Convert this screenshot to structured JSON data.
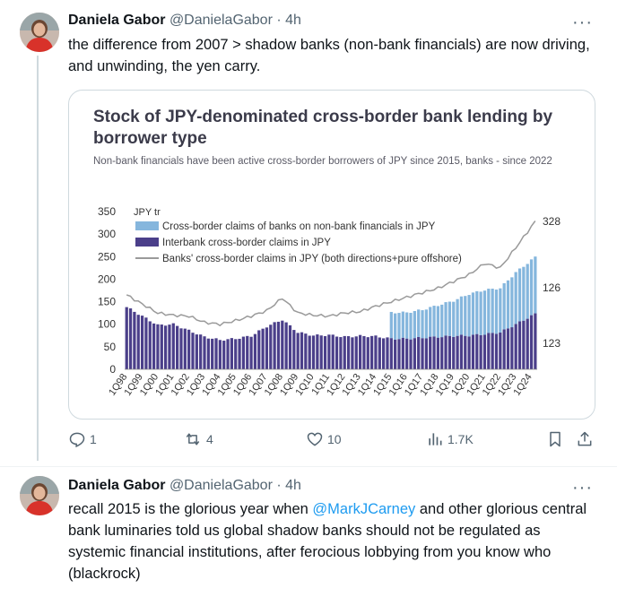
{
  "tweets": [
    {
      "name": "Daniela Gabor",
      "handle": "@DanielaGabor",
      "dot": "·",
      "time": "4h",
      "text": "the difference from 2007 > shadow banks  (non-bank financials) are now driving, and unwinding, the yen carry.",
      "replies": "1",
      "retweets": "4",
      "likes": "10",
      "views": "1.7K"
    },
    {
      "name": "Daniela Gabor",
      "handle": "@DanielaGabor",
      "dot": "·",
      "time": "4h",
      "text_before": "recall 2015 is the glorious year when ",
      "mention": "@MarkJCarney",
      "text_after": " and other glorious central bank luminaries told us global shadow banks should not be regulated as systemic financial institutions, after ferocious lobbying from you know who (blackrock)"
    }
  ],
  "more_glyph": "···",
  "colors": {
    "accent": "#1d9bf0",
    "text": "#0f1419",
    "muted": "#536471",
    "nonbank": "#85b6dd",
    "interbank": "#4b3f8a",
    "line": "#9a9a9a"
  },
  "chart_data": {
    "type": "bar",
    "title": "Stock of JPY-denominated cross-border bank lending by borrower type",
    "subtitle": "Non-bank financials have been active cross-border borrowers of JPY since 2015, banks - since 2022",
    "ylabel": "JPY tr",
    "ylim": [
      0,
      350
    ],
    "yticks": [
      0,
      50,
      100,
      150,
      200,
      250,
      300,
      350
    ],
    "xtick_labels": [
      "1Q98",
      "1Q99",
      "1Q00",
      "1Q01",
      "1Q02",
      "1Q03",
      "1Q04",
      "1Q05",
      "1Q06",
      "1Q07",
      "1Q08",
      "1Q09",
      "1Q10",
      "1Q11",
      "1Q12",
      "1Q13",
      "1Q14",
      "1Q15",
      "1Q16",
      "1Q17",
      "1Q18",
      "1Q19",
      "1Q20",
      "1Q21",
      "1Q22",
      "1Q23",
      "1Q24"
    ],
    "legend": [
      "Cross-border claims of banks on non-bank financials in JPY",
      "Interbank cross-border claims in JPY",
      "Banks' cross-border claims in JPY (both directions+pure offshore)"
    ],
    "end_labels": [
      "328",
      "126",
      "123"
    ],
    "series": [
      {
        "name": "Interbank cross-border claims in JPY",
        "anchors": [
          [
            1998,
            138
          ],
          [
            1999,
            118
          ],
          [
            2000,
            98
          ],
          [
            2001,
            100
          ],
          [
            2002,
            86
          ],
          [
            2003,
            72
          ],
          [
            2004,
            65
          ],
          [
            2005,
            68
          ],
          [
            2006,
            74
          ],
          [
            2007,
            95
          ],
          [
            2008,
            110
          ],
          [
            2009,
            82
          ],
          [
            2010,
            75
          ],
          [
            2011,
            76
          ],
          [
            2012,
            72
          ],
          [
            2013,
            74
          ],
          [
            2014,
            73
          ],
          [
            2015,
            68
          ],
          [
            2016,
            68
          ],
          [
            2017,
            70
          ],
          [
            2018,
            72
          ],
          [
            2019,
            74
          ],
          [
            2020,
            75
          ],
          [
            2021,
            78
          ],
          [
            2022,
            82
          ],
          [
            2023,
            100
          ],
          [
            2024.25,
            123
          ]
        ]
      },
      {
        "name": "Cross-border claims of banks on non-bank financials in JPY",
        "anchors": [
          [
            2014,
            0
          ],
          [
            2014.75,
            0
          ],
          [
            2015,
            58
          ],
          [
            2016,
            58
          ],
          [
            2017,
            62
          ],
          [
            2018,
            70
          ],
          [
            2019,
            78
          ],
          [
            2020,
            92
          ],
          [
            2021,
            98
          ],
          [
            2022,
            98
          ],
          [
            2023,
            115
          ],
          [
            2024.25,
            126
          ]
        ]
      },
      {
        "name": "Banks' cross-border claims in JPY (both directions+pure offshore)",
        "anchors": [
          [
            1998,
            165
          ],
          [
            1999,
            145
          ],
          [
            2000,
            125
          ],
          [
            2001,
            120
          ],
          [
            2002,
            118
          ],
          [
            2003,
            104
          ],
          [
            2004,
            100
          ],
          [
            2005,
            108
          ],
          [
            2006,
            118
          ],
          [
            2007,
            130
          ],
          [
            2008,
            158
          ],
          [
            2009,
            125
          ],
          [
            2010,
            120
          ],
          [
            2011,
            118
          ],
          [
            2012,
            125
          ],
          [
            2013,
            128
          ],
          [
            2014,
            140
          ],
          [
            2015,
            150
          ],
          [
            2016,
            160
          ],
          [
            2017,
            170
          ],
          [
            2018,
            180
          ],
          [
            2019,
            195
          ],
          [
            2020,
            210
          ],
          [
            2021,
            235
          ],
          [
            2022,
            225
          ],
          [
            2023,
            270
          ],
          [
            2024.25,
            328
          ]
        ]
      }
    ]
  }
}
